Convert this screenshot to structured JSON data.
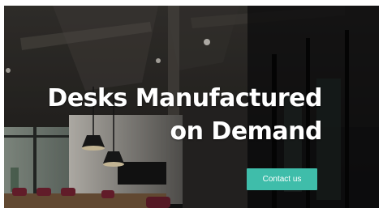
{
  "hero": {
    "title_line1": "Desks Manufactured",
    "title_line2": "on Demand",
    "cta_label": "Contact us",
    "accent_color": "#3fbdaa",
    "background_image": "office-interior-photo"
  }
}
